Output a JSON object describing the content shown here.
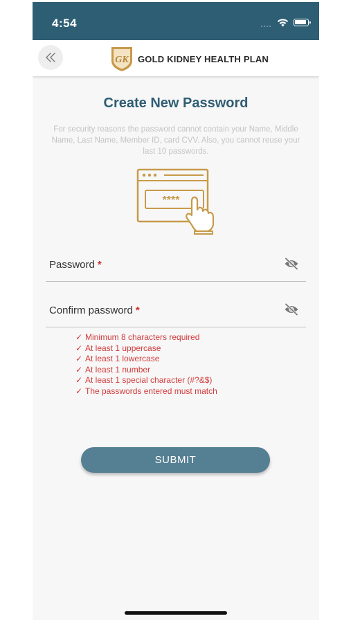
{
  "status_bar": {
    "time": "4:54"
  },
  "header": {
    "brand_name": "GOLD KIDNEY HEALTH PLAN",
    "logo_monogram": "GK"
  },
  "page": {
    "title": "Create New Password",
    "notice": "For security reasons the password cannot contain your Name, Middle Name, Last Name, Member ID, card CVV. Also, you cannot reuse your last 10 passwords.",
    "illustration_text": "****"
  },
  "form": {
    "password": {
      "label": "Password",
      "required_mark": "*",
      "icon": "eye-off-icon"
    },
    "confirm_password": {
      "label": "Confirm password",
      "required_mark": "*",
      "icon": "eye-off-icon"
    }
  },
  "rules": [
    {
      "check": "✓",
      "text": "Minimum 8 characters required"
    },
    {
      "check": "✓",
      "text": "At least 1 uppercase"
    },
    {
      "check": "✓",
      "text": "At least 1 lowercase"
    },
    {
      "check": "✓",
      "text": "At least 1 number"
    },
    {
      "check": "✓",
      "text": "At least 1 special character (#?&$)"
    },
    {
      "check": "✓",
      "text": "The passwords entered must match"
    }
  ],
  "actions": {
    "submit_label": "SUBMIT"
  },
  "colors": {
    "status_bar": "#2e5e74",
    "title": "#2f5d73",
    "gold": "#c79a4a",
    "rule_text": "#d23b3b",
    "submit_button": "#557f92"
  }
}
